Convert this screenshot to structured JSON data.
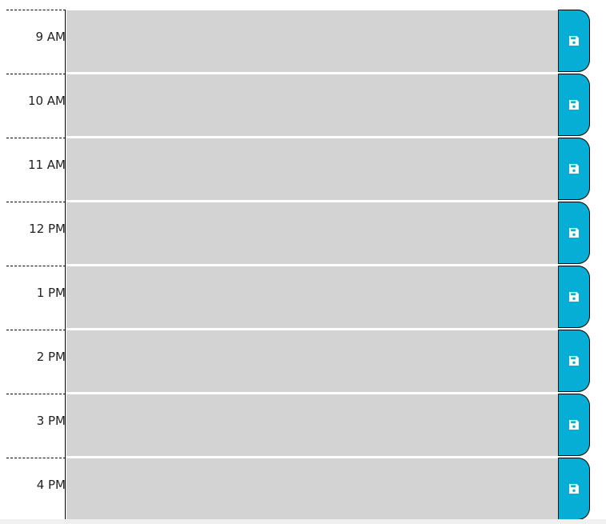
{
  "scheduler": {
    "time_blocks": [
      {
        "hour": "9 AM",
        "description": "",
        "save_icon": "floppy-disk-icon"
      },
      {
        "hour": "10 AM",
        "description": "",
        "save_icon": "floppy-disk-icon"
      },
      {
        "hour": "11 AM",
        "description": "",
        "save_icon": "floppy-disk-icon"
      },
      {
        "hour": "12 PM",
        "description": "",
        "save_icon": "floppy-disk-icon"
      },
      {
        "hour": "1 PM",
        "description": "",
        "save_icon": "floppy-disk-icon"
      },
      {
        "hour": "2 PM",
        "description": "",
        "save_icon": "floppy-disk-icon"
      },
      {
        "hour": "3 PM",
        "description": "",
        "save_icon": "floppy-disk-icon"
      },
      {
        "hour": "4 PM",
        "description": "",
        "save_icon": "floppy-disk-icon"
      }
    ]
  },
  "colors": {
    "save_button": "#06aed5",
    "description_background": "#d3d3d3",
    "border": "#000000"
  }
}
